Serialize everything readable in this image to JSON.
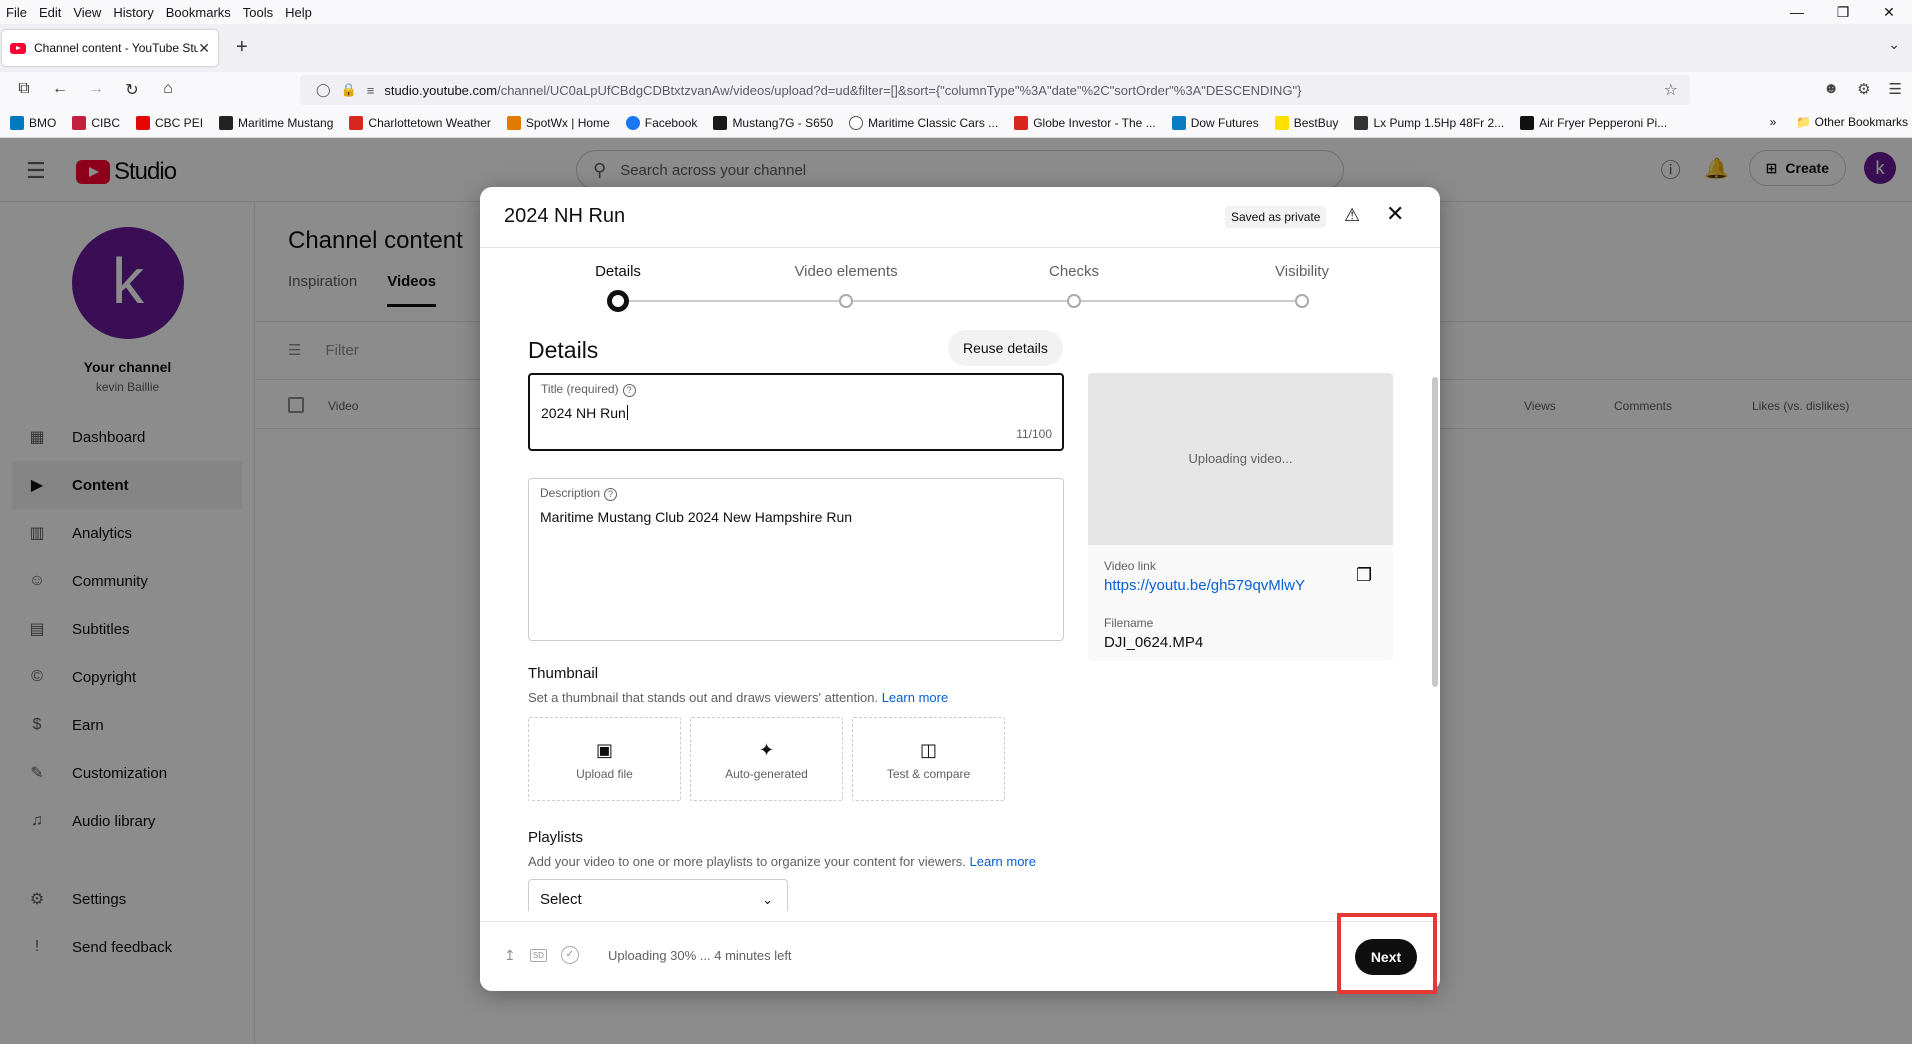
{
  "browser": {
    "menu": [
      "File",
      "Edit",
      "View",
      "History",
      "Bookmarks",
      "Tools",
      "Help"
    ],
    "tab_title": "Channel content - YouTube Stu",
    "url_host": "studio.youtube.com",
    "url_path": "/channel/UC0aLpUfCBdgCDBtxtzvanAw/videos/upload?d=ud&filter=[]&sort={\"columnType\"%3A\"date\"%2C\"sortOrder\"%3A\"DESCENDING\"}",
    "bookmarks": [
      {
        "label": "BMO",
        "color": "#0079c1"
      },
      {
        "label": "CIBC",
        "color": "#c41f3e"
      },
      {
        "label": "CBC PEI",
        "color": "#e60505"
      },
      {
        "label": "Maritime Mustang",
        "color": "#222222"
      },
      {
        "label": "Charlottetown Weather",
        "color": "#d7261e"
      },
      {
        "label": "SpotWx | Home",
        "color": "#e07b00"
      },
      {
        "label": "Facebook",
        "color": "#1877f2"
      },
      {
        "label": "Mustang7G - S650",
        "color": "#1a1a1a"
      },
      {
        "label": "Maritime Classic Cars ...",
        "color": "#555555"
      },
      {
        "label": "Globe Investor - The ...",
        "color": "#d7261e"
      },
      {
        "label": "Dow Futures",
        "color": "#0a7cc1"
      },
      {
        "label": "BestBuy",
        "color": "#ffe000"
      },
      {
        "label": "Lx Pump 1.5Hp 48Fr 2...",
        "color": "#333333"
      },
      {
        "label": "Air Fryer Pepperoni Pi...",
        "color": "#111111"
      }
    ],
    "other_bookmarks": "Other Bookmarks"
  },
  "studio": {
    "logo_text": "Studio",
    "search_placeholder": "Search across your channel",
    "create_label": "Create",
    "avatar_letter": "k",
    "sidebar": {
      "channel_label": "Your channel",
      "channel_owner": "kevin Baillie",
      "items": [
        {
          "label": "Dashboard",
          "icon": "dashboard-icon",
          "glyph": "▦"
        },
        {
          "label": "Content",
          "icon": "content-icon",
          "glyph": "▶"
        },
        {
          "label": "Analytics",
          "icon": "analytics-icon",
          "glyph": "▥"
        },
        {
          "label": "Community",
          "icon": "community-icon",
          "glyph": "☺"
        },
        {
          "label": "Subtitles",
          "icon": "subtitles-icon",
          "glyph": "▤"
        },
        {
          "label": "Copyright",
          "icon": "copyright-icon",
          "glyph": "©"
        },
        {
          "label": "Earn",
          "icon": "earn-icon",
          "glyph": "$"
        },
        {
          "label": "Customization",
          "icon": "customization-icon",
          "glyph": "✎"
        },
        {
          "label": "Audio library",
          "icon": "audio-library-icon",
          "glyph": "♫"
        }
      ],
      "bottom": [
        {
          "label": "Settings",
          "glyph": "⚙"
        },
        {
          "label": "Send feedback",
          "glyph": "!"
        }
      ]
    },
    "main": {
      "title": "Channel content",
      "tabs": [
        "Inspiration",
        "Videos"
      ],
      "filter_placeholder": "Filter",
      "columns": [
        "Video",
        "Views",
        "Comments",
        "Likes (vs. dislikes)"
      ]
    }
  },
  "dialog": {
    "title": "2024 NH Run",
    "saved_badge": "Saved as private",
    "steps": [
      "Details",
      "Video elements",
      "Checks",
      "Visibility"
    ],
    "section_title": "Details",
    "reuse_label": "Reuse details",
    "title_field": {
      "label": "Title (required)",
      "value": "2024 NH Run",
      "counter": "11/100"
    },
    "description_field": {
      "label": "Description",
      "value": "Maritime Mustang Club 2024 New Hampshire Run"
    },
    "preview": {
      "uploading": "Uploading video...",
      "link_label": "Video link",
      "link": "https://youtu.be/gh579qvMlwY",
      "filename_label": "Filename",
      "filename": "DJI_0624.MP4"
    },
    "thumbnail": {
      "heading": "Thumbnail",
      "subtitle": "Set a thumbnail that stands out and draws viewers' attention.",
      "learn_more": "Learn more",
      "options": [
        "Upload file",
        "Auto-generated",
        "Test & compare"
      ]
    },
    "playlists": {
      "heading": "Playlists",
      "subtitle": "Add your video to one or more playlists to organize your content for viewers.",
      "learn_more": "Learn more",
      "select_label": "Select"
    },
    "footer": {
      "hd_badge": "SD",
      "status": "Uploading 30% ... 4 minutes left",
      "next_label": "Next"
    }
  }
}
